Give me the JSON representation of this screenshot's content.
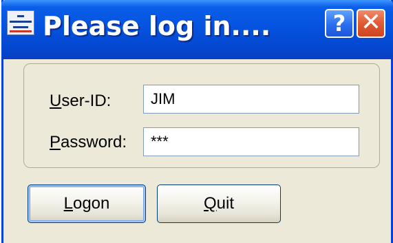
{
  "window": {
    "title": "Please log in....",
    "help_glyph": "?",
    "close_glyph": "✕",
    "app_icon": "app-logo-icon"
  },
  "form": {
    "user_label_accel": "U",
    "user_label_rest": "ser-ID:",
    "user_value": "JIM",
    "password_label_accel": "P",
    "password_label_rest": "assword:",
    "password_value": "***"
  },
  "buttons": {
    "logon_accel": "L",
    "logon_rest": "ogon",
    "quit_accel": "Q",
    "quit_rest": "uit"
  },
  "colors": {
    "titlebar": "#0553e0",
    "dialog_bg": "#ece9d8",
    "close_button": "#e05a35",
    "field_border": "#7f9db9"
  }
}
